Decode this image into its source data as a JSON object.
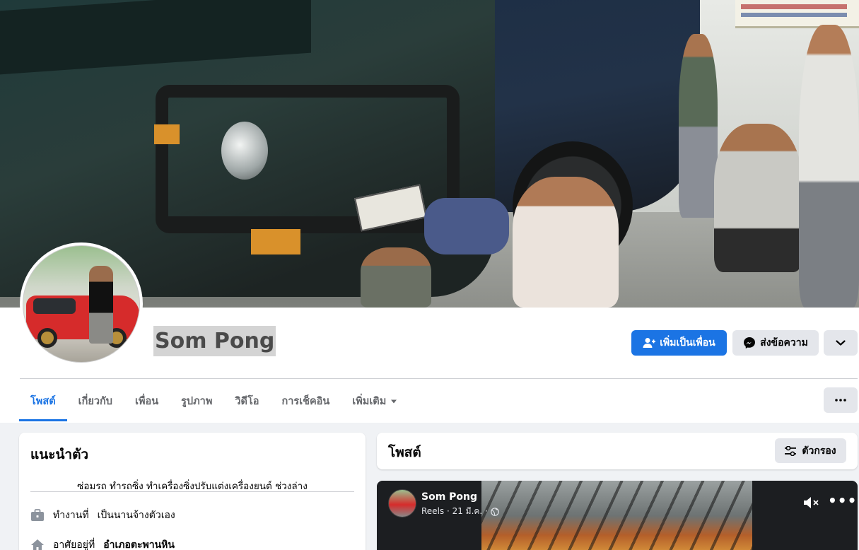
{
  "profile": {
    "name": "Som Pong"
  },
  "actions": {
    "add_friend": "เพิ่มเป็นเพื่อน",
    "message": "ส่งข้อความ"
  },
  "tabs": [
    {
      "label": "โพสต์"
    },
    {
      "label": "เกี่ยวกับ"
    },
    {
      "label": "เพื่อน"
    },
    {
      "label": "รูปภาพ"
    },
    {
      "label": "วิดีโอ"
    },
    {
      "label": "การเช็คอิน"
    },
    {
      "label": "เพิ่มเติม"
    }
  ],
  "intro": {
    "title": "แนะนำตัว",
    "bio": "ซ่อมรถ ทำรถซิ่ง ทำเครื่องซิ่งปรับแต่งเครื่องยนต์ ช่วงล่าง",
    "work_prefix": "ทำงานที่",
    "work_value": "เป็นนานจ้างตัวเอง",
    "lives_prefix": "อาศัยอยู่ที่",
    "lives_value": "อำเภอตะพานหิน"
  },
  "posts": {
    "title": "โพสต์",
    "filter_label": "ตัวกรอง"
  },
  "reel": {
    "author": "Som Pong",
    "meta": "Reels · 21 มี.ค. ·"
  },
  "colors": {
    "accent": "#1b74e4",
    "page_bg": "#f0f2f5",
    "button_gray": "#e4e6eb"
  }
}
